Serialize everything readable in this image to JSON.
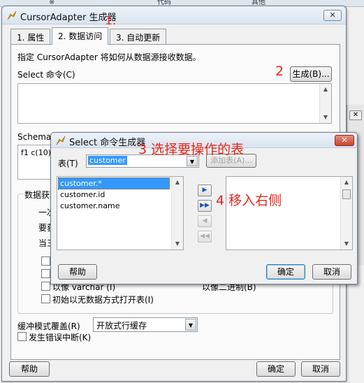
{
  "background": {
    "columns": [
      "※",
      "代码",
      "其他"
    ]
  },
  "main_window": {
    "title": "CursorAdapter 生成器",
    "close_glyph": "✕",
    "tabs": [
      {
        "label": "1. 属性"
      },
      {
        "label": "2. 数据访问"
      },
      {
        "label": "3. 自动更新"
      }
    ],
    "instruction": "指定 CursorAdapter 将如何从数据源接收数据。",
    "select_cmd_label": "Select 命令(C)",
    "build_button": "生成(B)...",
    "schema_label": "Schema",
    "schema_value": "f1 c(10)",
    "data_group_label": "数据获取",
    "data_rows": [
      "一次",
      "要获",
      "当三"
    ],
    "checkboxes": [
      {
        "label": "",
        "checked": false
      },
      {
        "label": "",
        "checked": false
      },
      {
        "label": "以像 varchar (I)",
        "checked": false
      },
      {
        "label": "初始以无数据方式打开表(I)",
        "checked": false
      }
    ],
    "right_check_label": "以像二进制(B)",
    "buffer_label": "缓冲模式覆盖(R)",
    "buffer_value": "开放式行缓存",
    "error_label": "发生错误中断(K)",
    "help_button": "帮助",
    "ok_button": "确定",
    "cancel_button": "取消"
  },
  "select_dialog": {
    "title": "Select 命令生成器",
    "close_glyph": "✕",
    "table_label": "表(T)",
    "table_value": "customer",
    "add_table_button": "添加表(A)...",
    "fields": [
      "customer.*",
      "customer.id",
      "customer.name"
    ],
    "selected_field_index": 0,
    "move_buttons": [
      {
        "glyph": "▶",
        "enabled": true
      },
      {
        "glyph": "▶▶",
        "enabled": true
      },
      {
        "glyph": "◀",
        "enabled": false
      },
      {
        "glyph": "◀◀",
        "enabled": false
      }
    ],
    "help_button": "帮助",
    "ok_button": "确定",
    "cancel_button": "取消"
  },
  "annotations": {
    "a1": "1.",
    "a2": "2",
    "a3": "3 选择要操作的表",
    "a4": "4 移入右侧"
  },
  "colors": {
    "annotation": "#e8281c",
    "selection": "#3399ff"
  }
}
